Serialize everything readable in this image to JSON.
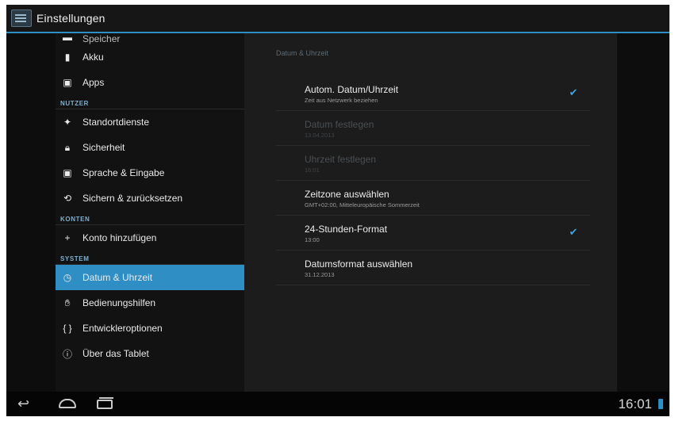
{
  "actionbar": {
    "title": "Einstellungen"
  },
  "sidebar": {
    "items": [
      {
        "label": "Speicher",
        "icon": "storage-icon",
        "partial": true
      },
      {
        "label": "Akku",
        "icon": "battery-icon"
      },
      {
        "label": "Apps",
        "icon": "apps-icon"
      },
      {
        "section": "NUTZER"
      },
      {
        "label": "Standortdienste",
        "icon": "location-icon"
      },
      {
        "label": "Sicherheit",
        "icon": "lock-icon"
      },
      {
        "label": "Sprache & Eingabe",
        "icon": "keyboard-icon"
      },
      {
        "label": "Sichern & zurücksetzen",
        "icon": "backup-icon"
      },
      {
        "section": "KONTEN"
      },
      {
        "label": "Konto hinzufügen",
        "icon": "plus-icon"
      },
      {
        "section": "SYSTEM"
      },
      {
        "label": "Datum & Uhrzeit",
        "icon": "clock-icon",
        "selected": true
      },
      {
        "label": "Bedienungshilfen",
        "icon": "accessibility-icon"
      },
      {
        "label": "Entwickleroptionen",
        "icon": "braces-icon"
      },
      {
        "label": "Über das Tablet",
        "icon": "info-icon"
      }
    ]
  },
  "panel": {
    "header": "Datum & Uhrzeit",
    "rows": [
      {
        "title": "Autom. Datum/Uhrzeit",
        "sub": "Zeit aus Netzwerk beziehen",
        "checked": true
      },
      {
        "title": "Datum festlegen",
        "sub": "13.04.2013",
        "disabled": true
      },
      {
        "title": "Uhrzeit festlegen",
        "sub": "16:01",
        "disabled": true
      },
      {
        "title": "Zeitzone auswählen",
        "sub": "GMT+02:00, Mitteleuropäische Sommerzeit"
      },
      {
        "title": "24-Stunden-Format",
        "sub": "13:00",
        "checked": true
      },
      {
        "title": "Datumsformat auswählen",
        "sub": "31.12.2013"
      }
    ]
  },
  "statusbar": {
    "time": "16:01"
  },
  "colors": {
    "accent": "#2f8fc4",
    "check": "#3fa3e0",
    "background": "#0d0d0d",
    "panel": "#1c1c1c"
  }
}
